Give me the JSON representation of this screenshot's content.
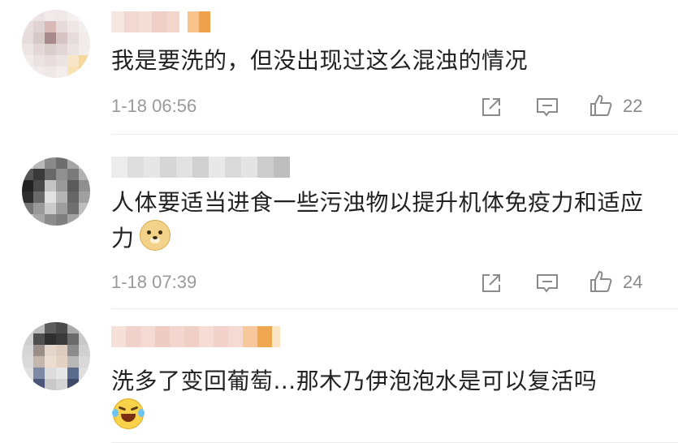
{
  "comments": [
    {
      "text": "我是要洗的，但没出现过这么混浊的情况",
      "emoji": "",
      "time": "1-18 06:56",
      "likes": "22",
      "icons": {
        "share": "share-icon",
        "reply": "comment-icon",
        "like": "thumbs-up-icon"
      }
    },
    {
      "text": "人体要适当进食一些污浊物以提升机体免疫力和适应力",
      "emoji": "doge-emoji",
      "time": "1-18 07:39",
      "likes": "24",
      "icons": {
        "share": "share-icon",
        "reply": "comment-icon",
        "like": "thumbs-up-icon"
      }
    },
    {
      "text": "洗多了变回葡萄...那木乃伊泡泡水是可以复活吗",
      "emoji": "laugh-cry-emoji",
      "time": "",
      "likes": "",
      "icons": {}
    }
  ],
  "colors": {
    "text": "#222222",
    "meta": "#9a9a9a",
    "icon": "#8a8a8a",
    "divider": "#ececec"
  }
}
